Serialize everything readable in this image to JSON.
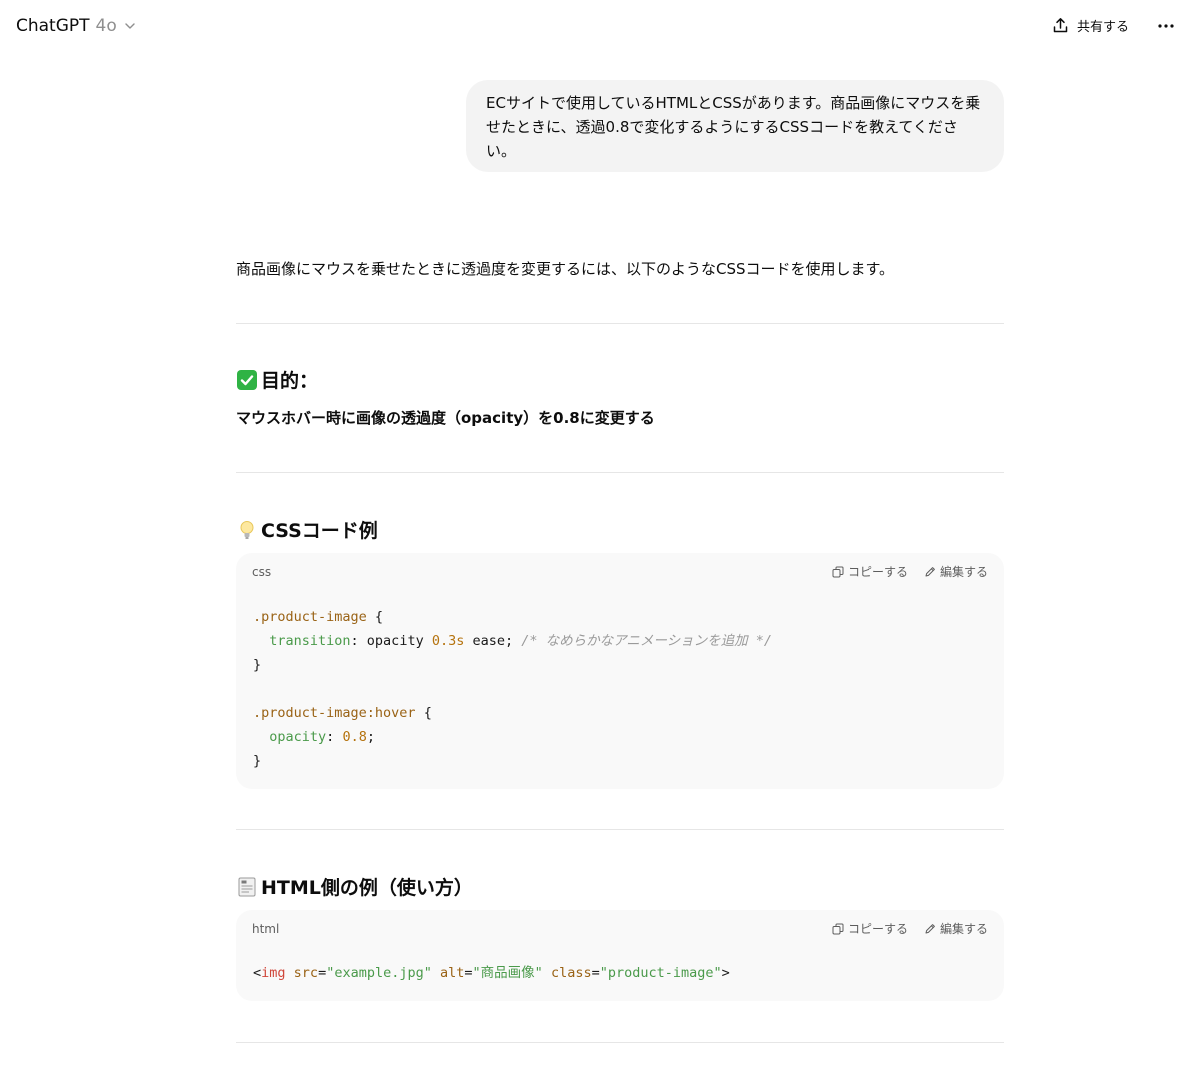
{
  "header": {
    "app_title": "ChatGPT",
    "model": "4o",
    "share_label": "共有する"
  },
  "user_message": "ECサイトで使用しているHTMLとCSSがあります。商品画像にマウスを乗せたときに、透過0.8で変化するようにするCSSコードを教えてください。",
  "assistant": {
    "intro": "商品画像にマウスを乗せたときに透過度を変更するには、以下のようなCSSコードを使用します。",
    "goal_heading": "目的：",
    "goal_text": "マウスホバー時に画像の透過度（opacity）を0.8に変更する",
    "css_heading": "CSSコード例",
    "html_heading": "HTML側の例（使い方）",
    "css_block": {
      "lang": "css",
      "copy_label": "コピーする",
      "edit_label": "編集する",
      "line1_selector": ".product-image",
      "line1_brace": " {",
      "line2_prop": "transition",
      "line2_value_a": ": opacity ",
      "line2_num": "0.3s",
      "line2_value_b": " ease; ",
      "line2_comment": "/* なめらかなアニメーションを追加 */",
      "line3": "}",
      "line5_selector": ".product-image:hover",
      "line5_brace": " {",
      "line6_prop": "opacity",
      "line6_colon": ": ",
      "line6_num": "0.8",
      "line6_semi": ";",
      "line7": "}"
    },
    "html_block": {
      "lang": "html",
      "copy_label": "コピーする",
      "edit_label": "編集する",
      "lt": "<",
      "tag": "img",
      "attr1": "src",
      "val1": "\"example.jpg\"",
      "attr2": "alt",
      "val2": "\"商品画像\"",
      "attr3": "class",
      "val3": "\"product-image\"",
      "gt": ">",
      "eq": "="
    }
  },
  "colors": {
    "bubble_bg": "#f3f3f3",
    "code_bg": "#f9f9f9",
    "check_green": "#2fb344"
  }
}
